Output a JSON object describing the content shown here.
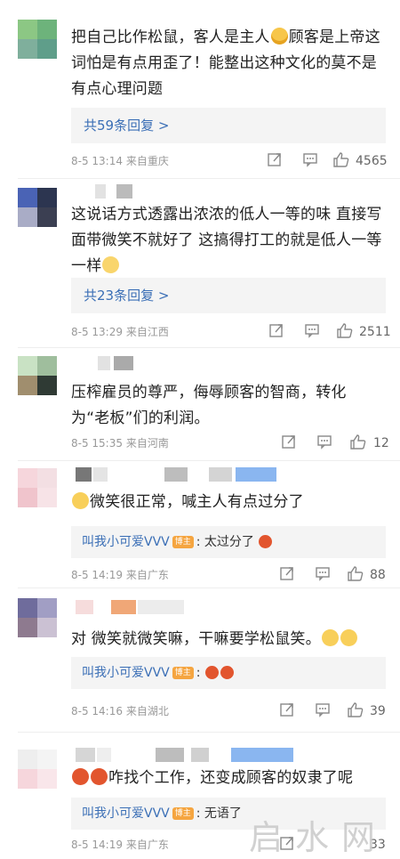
{
  "comments": [
    {
      "text_a": "把自己比作松鼠，客人是主人",
      "text_b": "顾客是上帝这词怕是有点用歪了！能整出这种文化的莫不是有点心理问题",
      "replies_label": "共59条回复 >",
      "timestamp": "8-5 13:14",
      "location": "来自重庆",
      "likes": "4565"
    },
    {
      "text_a": "这说话方式透露出浓浓的低人一等的味 直接写面带微笑不就好了 这搞得打工的就是低人一等一样",
      "replies_label": "共23条回复 >",
      "timestamp": "8-5 13:29",
      "location": "来自江西",
      "likes": "2511"
    },
    {
      "text_a": "压榨雇员的尊严，侮辱顾客的智商，转化为“老板”们的利润。",
      "timestamp": "8-5 15:35",
      "location": "来自河南",
      "likes": "12"
    },
    {
      "text_a": "微笑很正常，喊主人有点过分了",
      "quote_name": "叫我小可爱VVV",
      "quote_badge": "博主",
      "quote_text": ": 太过分了",
      "timestamp": "8-5 14:19",
      "location": "来自广东",
      "likes": "88"
    },
    {
      "text_a": "对 微笑就微笑嘛，干嘛要学松鼠笑。",
      "quote_name": "叫我小可爱VVV",
      "quote_badge": "博主",
      "quote_text": ":",
      "timestamp": "8-5 14:16",
      "location": "来自湖北",
      "likes": "39"
    },
    {
      "text_a": "咋找个工作，还变成顾客的奴隶了呢",
      "quote_name": "叫我小可爱VVV",
      "quote_badge": "博主",
      "quote_text": ": 无语了",
      "timestamp": "8-5 14:19",
      "location": "来自广东",
      "likes": "33"
    }
  ],
  "watermark": "启水网",
  "colors": {
    "link": "#3b6fb6",
    "meta": "#999999",
    "badge": "#f5a540"
  },
  "icons": [
    "share-icon",
    "comment-icon",
    "thumbs-up-icon"
  ]
}
